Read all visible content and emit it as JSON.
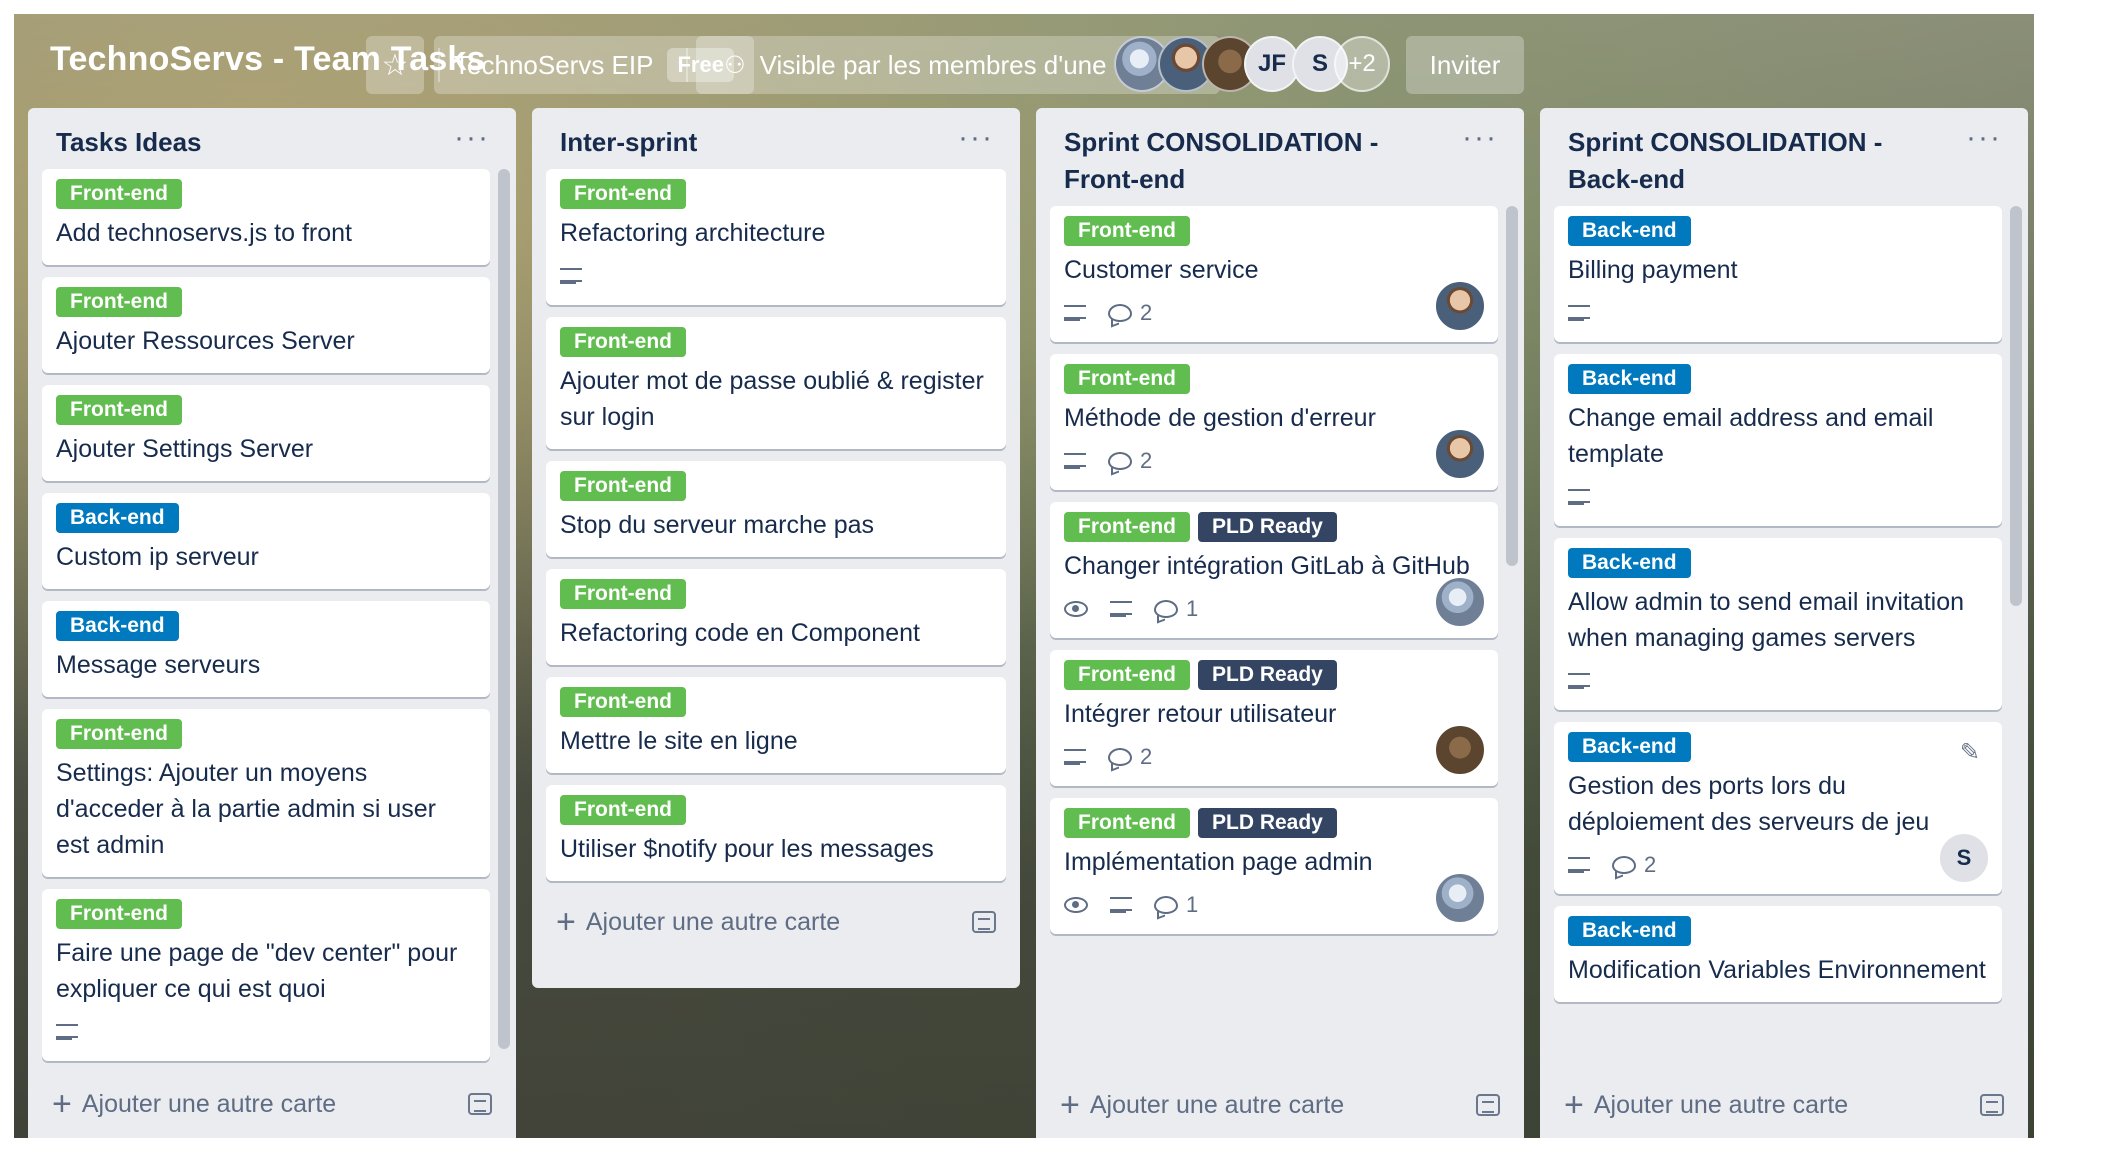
{
  "header": {
    "title": "TechnoServs - Team Tasks",
    "team_name": "TechnoServs EIP",
    "team_plan": "Free",
    "visibility": "Visible par les membres d'une équipe",
    "members": [
      "JF",
      "S"
    ],
    "more_members": "+2",
    "invite_label": "Inviter"
  },
  "add_card_label": "Ajouter une autre carte",
  "lists": [
    {
      "title": "Tasks Ideas",
      "cards": [
        {
          "labels": [
            "Front-end"
          ],
          "title": "Add technoservs.js to front"
        },
        {
          "labels": [
            "Front-end"
          ],
          "title": "Ajouter Ressources Server"
        },
        {
          "labels": [
            "Front-end"
          ],
          "title": "Ajouter Settings Server"
        },
        {
          "labels": [
            "Back-end"
          ],
          "title": "Custom ip serveur"
        },
        {
          "labels": [
            "Back-end"
          ],
          "title": "Message serveurs"
        },
        {
          "labels": [
            "Front-end"
          ],
          "title": "Settings: Ajouter un moyens d'acceder à la partie admin si user est admin"
        },
        {
          "labels": [
            "Front-end"
          ],
          "title": "Faire une page de \"dev center\" pour expliquer ce qui est quoi"
        }
      ]
    },
    {
      "title": "Inter-sprint",
      "cards": [
        {
          "labels": [
            "Front-end"
          ],
          "title": "Refactoring architecture"
        },
        {
          "labels": [
            "Front-end"
          ],
          "title": "Ajouter mot de passe oublié & register sur login"
        },
        {
          "labels": [
            "Front-end"
          ],
          "title": "Stop du serveur marche pas"
        },
        {
          "labels": [
            "Front-end"
          ],
          "title": "Refactoring code en Component"
        },
        {
          "labels": [
            "Front-end"
          ],
          "title": "Mettre le site en ligne"
        },
        {
          "labels": [
            "Front-end"
          ],
          "title": "Utiliser $notify pour les messages"
        }
      ]
    },
    {
      "title": "Sprint CONSOLIDATION - Front-end",
      "cards": [
        {
          "labels": [
            "Front-end"
          ],
          "title": "Customer service",
          "comments": "2"
        },
        {
          "labels": [
            "Front-end"
          ],
          "title": "Méthode de gestion d'erreur",
          "comments": "2"
        },
        {
          "labels": [
            "Front-end",
            "PLD Ready"
          ],
          "title": "Changer intégration GitLab à GitHub",
          "comments": "1"
        },
        {
          "labels": [
            "Front-end",
            "PLD Ready"
          ],
          "title": "Intégrer retour utilisateur",
          "comments": "2"
        },
        {
          "labels": [
            "Front-end",
            "PLD Ready"
          ],
          "title": "Implémentation page admin",
          "comments": "1"
        }
      ]
    },
    {
      "title": "Sprint CONSOLIDATION - Back-end",
      "cards": [
        {
          "labels": [
            "Back-end"
          ],
          "title": "Billing payment"
        },
        {
          "labels": [
            "Back-end"
          ],
          "title": "Change email address and email template"
        },
        {
          "labels": [
            "Back-end"
          ],
          "title": "Allow admin to send email invitation when managing games servers"
        },
        {
          "labels": [
            "Back-end"
          ],
          "title": "Gestion des ports lors du déploiement des serveurs de jeu",
          "comments": "2",
          "member": "S"
        },
        {
          "labels": [
            "Back-end"
          ],
          "title": "Modification Variables Environnement"
        }
      ]
    }
  ]
}
